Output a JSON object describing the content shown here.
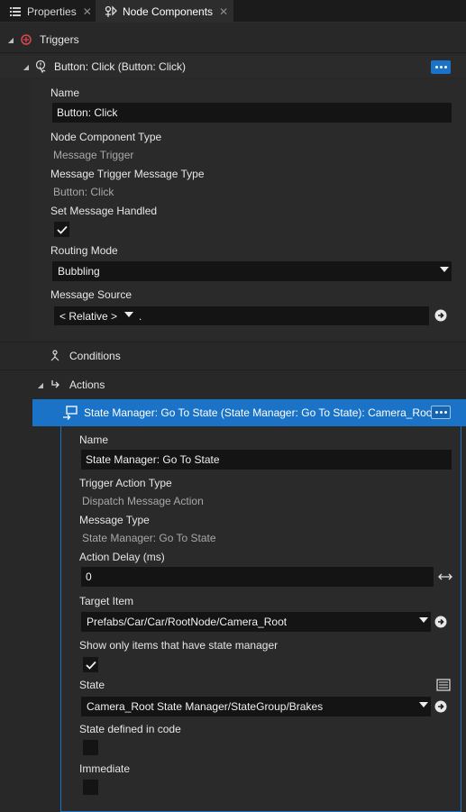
{
  "tabs": [
    {
      "label": "Properties"
    },
    {
      "label": "Node Components"
    }
  ],
  "triggers": {
    "section_label": "Triggers",
    "trigger": {
      "title": "Button: Click (Button: Click)",
      "name_label": "Name",
      "name_value": "Button: Click",
      "type_label": "Node Component Type",
      "type_value": "Message Trigger",
      "msg_type_label": "Message Trigger Message Type",
      "msg_type_value": "Button: Click",
      "handled_label": "Set Message Handled",
      "handled_checked": true,
      "routing_label": "Routing Mode",
      "routing_value": "Bubbling",
      "source_label": "Message Source",
      "source_mode": "< Relative >",
      "source_path": "."
    },
    "conditions_label": "Conditions",
    "actions_label": "Actions",
    "action": {
      "title": "State Manager: Go To State (State Manager: Go To State): Camera_Root",
      "name_label": "Name",
      "name_value": "State Manager: Go To State",
      "trigger_type_label": "Trigger Action Type",
      "trigger_type_value": "Dispatch Message Action",
      "msg_type_label": "Message Type",
      "msg_type_value": "State Manager: Go To State",
      "delay_label": "Action Delay (ms)",
      "delay_value": "0",
      "target_label": "Target Item",
      "target_value": "Prefabs/Car/Car/RootNode/Camera_Root",
      "only_state_label": "Show only items that have state manager",
      "only_state_checked": true,
      "state_label": "State",
      "state_value": "Camera_Root State Manager/StateGroup/Brakes",
      "in_code_label": "State defined in code",
      "in_code_checked": false,
      "immediate_label": "Immediate",
      "immediate_checked": false
    }
  },
  "colors": {
    "accent": "#1a73c7",
    "selected_row": "#1a73c7",
    "panel_bg": "#282828",
    "input_bg": "#141414"
  }
}
